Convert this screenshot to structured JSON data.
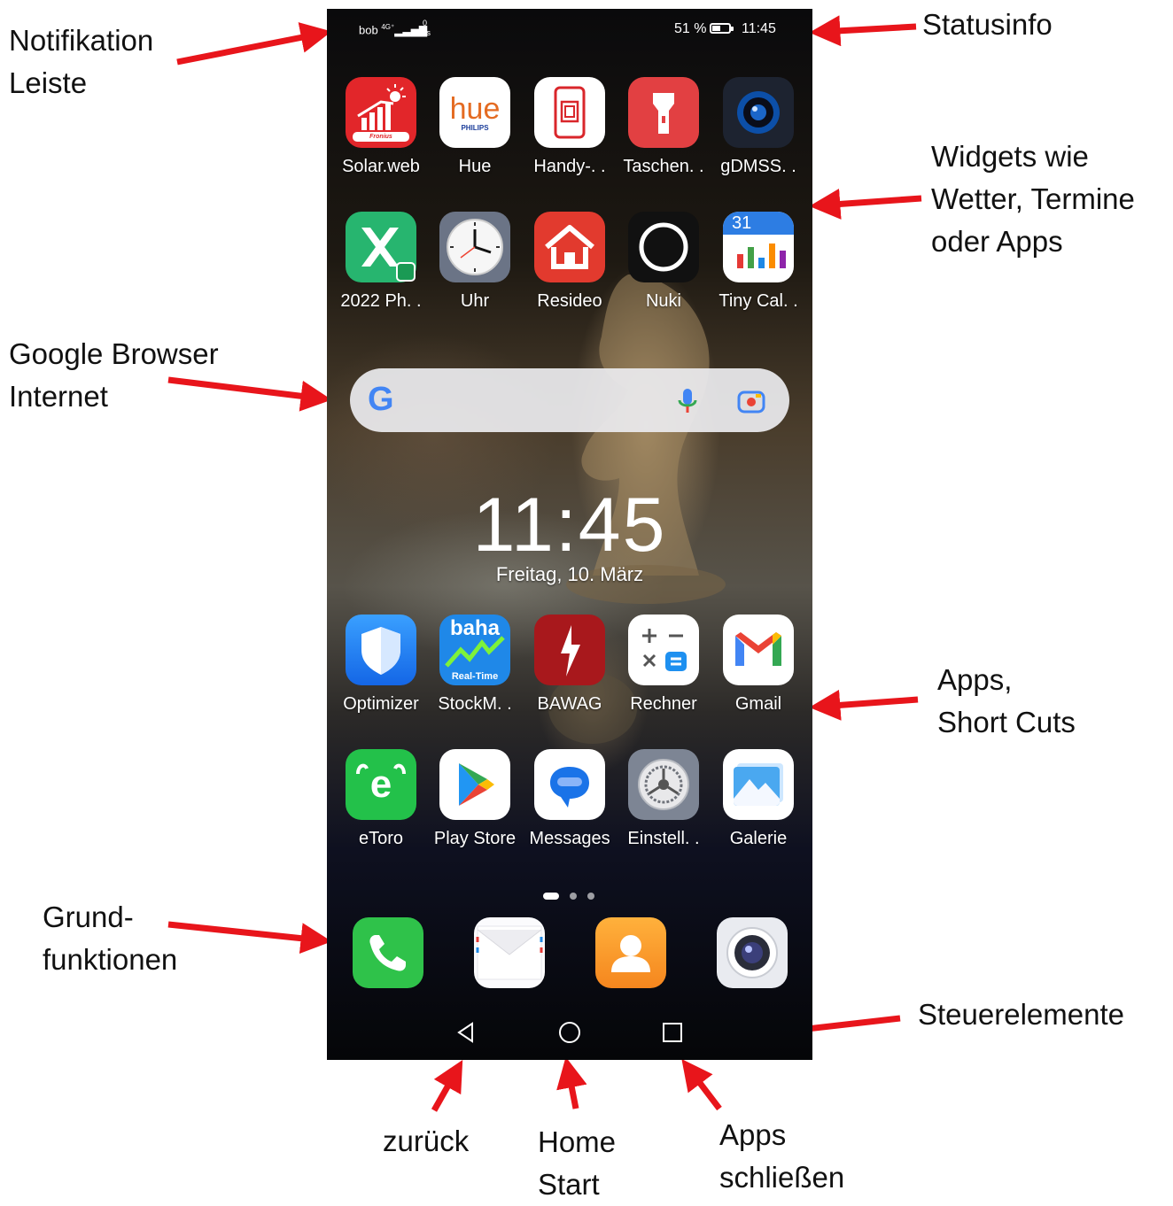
{
  "annotations": {
    "notification_bar": [
      "Notifikation",
      "Leiste"
    ],
    "status_info": [
      "Statusinfo"
    ],
    "widgets": [
      "Widgets wie",
      "Wetter, Termine",
      "oder Apps"
    ],
    "google_browser": [
      "Google Browser",
      "Internet"
    ],
    "apps_shortcuts": [
      "Apps,",
      "Short Cuts"
    ],
    "basic_functions": [
      "Grund-",
      "funktionen"
    ],
    "controls": [
      "Steuerelemente"
    ],
    "back": [
      "zurück"
    ],
    "home": [
      "Home",
      "Start"
    ],
    "close_apps": [
      "Apps",
      "schließen"
    ]
  },
  "status_bar": {
    "carrier": "bob",
    "network_type": "4G⁺",
    "net_speed_value": "0",
    "net_speed_unit": "K/s",
    "battery_text": "51 %",
    "battery_level": 0.51,
    "time": "11:45"
  },
  "apps_top_row_1": [
    {
      "label": "Solar.web",
      "icon": "solarweb-icon"
    },
    {
      "label": "Hue",
      "icon": "hue-icon"
    },
    {
      "label": "Handy-. .",
      "icon": "phone-clone-icon"
    },
    {
      "label": "Taschen. .",
      "icon": "flashlight-icon"
    },
    {
      "label": "gDMSS. .",
      "icon": "camera-lens-icon"
    }
  ],
  "apps_top_row_2": [
    {
      "label": "2022 Ph. .",
      "icon": "spreadsheet-icon"
    },
    {
      "label": "Uhr",
      "icon": "clock-icon"
    },
    {
      "label": "Resideo",
      "icon": "house-icon"
    },
    {
      "label": "Nuki",
      "icon": "ring-icon"
    },
    {
      "label": "Tiny Cal. .",
      "icon": "calendar-icon"
    }
  ],
  "icon_text": {
    "hue_word": "hue",
    "hue_brand": "PHILIPS",
    "fronius_brand": "Fronius",
    "calendar_day": "31",
    "baha_word": "baha",
    "baha_sub": "Real-Time",
    "etoro_letter": "e"
  },
  "search_widget": {
    "google_letter": "G"
  },
  "clock_widget": {
    "time": "11:45",
    "date": "Freitag, 10. März"
  },
  "apps_bottom_row_1": [
    {
      "label": "Optimizer",
      "icon": "shield-icon"
    },
    {
      "label": "StockM. .",
      "icon": "stock-chart-icon"
    },
    {
      "label": "BAWAG",
      "icon": "bawag-icon"
    },
    {
      "label": "Rechner",
      "icon": "calculator-icon"
    },
    {
      "label": "Gmail",
      "icon": "gmail-icon"
    }
  ],
  "apps_bottom_row_2": [
    {
      "label": "eToro",
      "icon": "etoro-icon"
    },
    {
      "label": "Play Store",
      "icon": "play-store-icon"
    },
    {
      "label": "Messages",
      "icon": "messages-icon"
    },
    {
      "label": "Einstell. .",
      "icon": "settings-gear-icon"
    },
    {
      "label": "Galerie",
      "icon": "gallery-icon"
    }
  ],
  "page_indicator": {
    "pages": 3,
    "current": 1
  },
  "dock": [
    "phone-icon",
    "mail-icon",
    "contacts-icon",
    "camera-icon"
  ],
  "nav": [
    "back-icon",
    "home-icon",
    "recents-icon"
  ],
  "colors": {
    "arrow": "#e8151b",
    "accent_green": "#2fc24a",
    "accent_red": "#e23a2e"
  }
}
